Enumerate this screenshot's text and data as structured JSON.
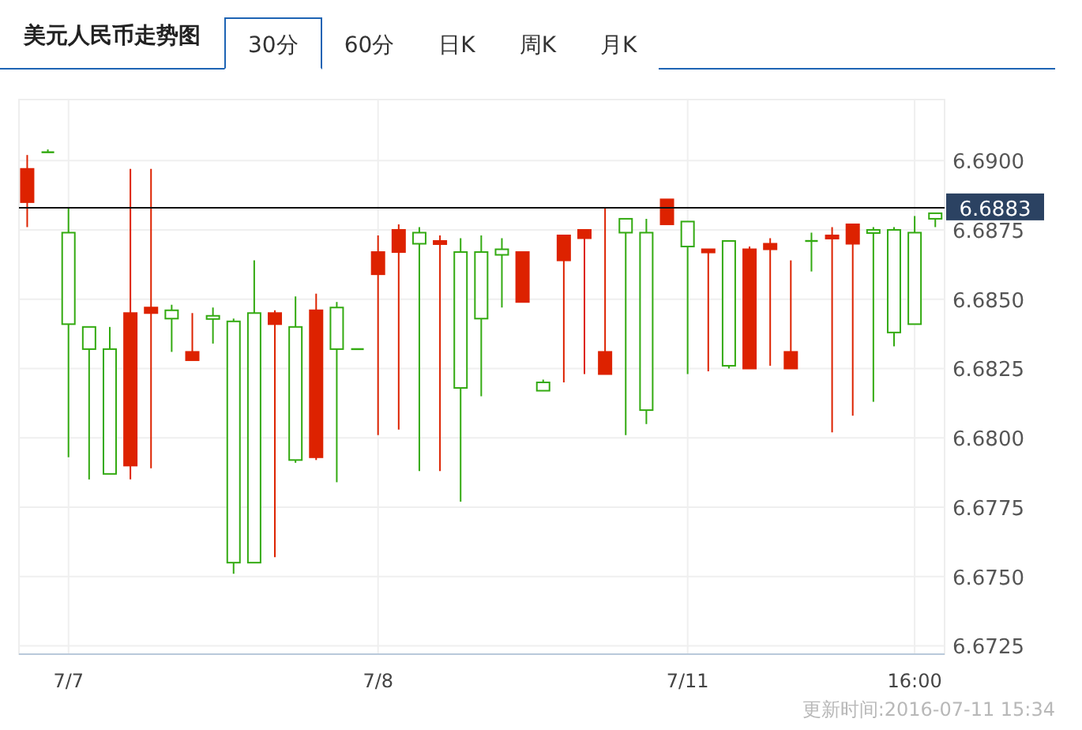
{
  "header": {
    "title": "美元人民币走势图",
    "tabs": [
      {
        "label": "30分",
        "selected": true
      },
      {
        "label": "60分",
        "selected": false
      },
      {
        "label": "日K",
        "selected": false
      },
      {
        "label": "周K",
        "selected": false
      },
      {
        "label": "月K",
        "selected": false
      }
    ]
  },
  "chart": {
    "chart_data": {
      "type": "candlestick",
      "grid": true,
      "categories": [
        null,
        null,
        "7/7",
        null,
        null,
        null,
        null,
        null,
        null,
        null,
        null,
        null,
        null,
        null,
        null,
        null,
        null,
        "7/8",
        null,
        null,
        null,
        null,
        null,
        null,
        null,
        null,
        null,
        null,
        null,
        null,
        null,
        null,
        "7/11",
        null,
        null,
        null,
        null,
        null,
        null,
        null,
        null,
        null,
        null,
        "16:00",
        null
      ],
      "ylim": [
        6.6722,
        6.6922
      ],
      "yticks": [
        {
          "value": 6.6725,
          "label": "6.6725"
        },
        {
          "value": 6.675,
          "label": "6.6750"
        },
        {
          "value": 6.6775,
          "label": "6.6775"
        },
        {
          "value": 6.68,
          "label": "6.6800"
        },
        {
          "value": 6.6825,
          "label": "6.6825"
        },
        {
          "value": 6.685,
          "label": "6.6850"
        },
        {
          "value": 6.6875,
          "label": "6.6875"
        },
        {
          "value": 6.69,
          "label": "6.6900"
        }
      ],
      "ohlc": [
        [
          6.6885,
          6.6902,
          6.6876,
          6.6897
        ],
        [
          6.6903,
          6.6904,
          6.6903,
          6.6903
        ],
        [
          6.6874,
          6.6883,
          6.6793,
          6.6841
        ],
        [
          6.684,
          6.684,
          6.6785,
          6.6832
        ],
        [
          6.6832,
          6.684,
          6.6787,
          6.6787
        ],
        [
          6.679,
          6.6897,
          6.6785,
          6.6845
        ],
        [
          6.6845,
          6.6897,
          6.6789,
          6.6847
        ],
        [
          6.6846,
          6.6848,
          6.6831,
          6.6843
        ],
        [
          6.6828,
          6.6845,
          6.6828,
          6.6831
        ],
        [
          6.6844,
          6.6847,
          6.6834,
          6.6843
        ],
        [
          6.6842,
          6.6843,
          6.6751,
          6.6755
        ],
        [
          6.6845,
          6.6864,
          6.6755,
          6.6755
        ],
        [
          6.6841,
          6.6846,
          6.6757,
          6.6845
        ],
        [
          6.684,
          6.6851,
          6.6791,
          6.6792
        ],
        [
          6.6793,
          6.6852,
          6.6792,
          6.6846
        ],
        [
          6.6847,
          6.6849,
          6.6784,
          6.6832
        ],
        [
          6.6832,
          6.6832,
          6.6832,
          6.6832
        ],
        [
          6.6859,
          6.6873,
          6.6801,
          6.6867
        ],
        [
          6.6867,
          6.6877,
          6.6803,
          6.6875
        ],
        [
          6.6874,
          6.6876,
          6.6788,
          6.687
        ],
        [
          6.687,
          6.6873,
          6.6788,
          6.6871
        ],
        [
          6.6867,
          6.6872,
          6.6777,
          6.6818
        ],
        [
          6.6867,
          6.6873,
          6.6815,
          6.6843
        ],
        [
          6.6868,
          6.6872,
          6.6847,
          6.6866
        ],
        [
          6.6849,
          6.6867,
          6.6849,
          6.6867
        ],
        [
          6.682,
          6.6821,
          6.6817,
          6.6817
        ],
        [
          6.6864,
          6.6873,
          6.682,
          6.6873
        ],
        [
          6.6872,
          6.6875,
          6.6823,
          6.6875
        ],
        [
          6.6823,
          6.6883,
          6.6823,
          6.6831
        ],
        [
          6.6879,
          6.6879,
          6.6801,
          6.6874
        ],
        [
          6.6874,
          6.6879,
          6.6805,
          6.681
        ],
        [
          6.6877,
          6.6886,
          6.6877,
          6.6886
        ],
        [
          6.6878,
          6.6878,
          6.6823,
          6.6869
        ],
        [
          6.6867,
          6.6868,
          6.6824,
          6.6868
        ],
        [
          6.6871,
          6.6871,
          6.6825,
          6.6826
        ],
        [
          6.6825,
          6.6869,
          6.6825,
          6.6868
        ],
        [
          6.6868,
          6.6872,
          6.6826,
          6.687
        ],
        [
          6.6825,
          6.6864,
          6.6825,
          6.6831
        ],
        [
          6.6871,
          6.6874,
          6.686,
          6.6871
        ],
        [
          6.6872,
          6.6876,
          6.6802,
          6.6873
        ],
        [
          6.687,
          6.6877,
          6.6808,
          6.6877
        ],
        [
          6.6875,
          6.6876,
          6.6813,
          6.6874
        ],
        [
          6.6875,
          6.6876,
          6.6833,
          6.6838
        ],
        [
          6.6874,
          6.688,
          6.6841,
          6.6841
        ],
        [
          6.6881,
          6.6881,
          6.6876,
          6.6879
        ]
      ],
      "ref_lines": [
        {
          "axis": "y",
          "value": 6.6883,
          "label": "6.6883"
        }
      ]
    }
  },
  "footer": {
    "update_time": "更新时间:2016-07-11 15:34"
  }
}
